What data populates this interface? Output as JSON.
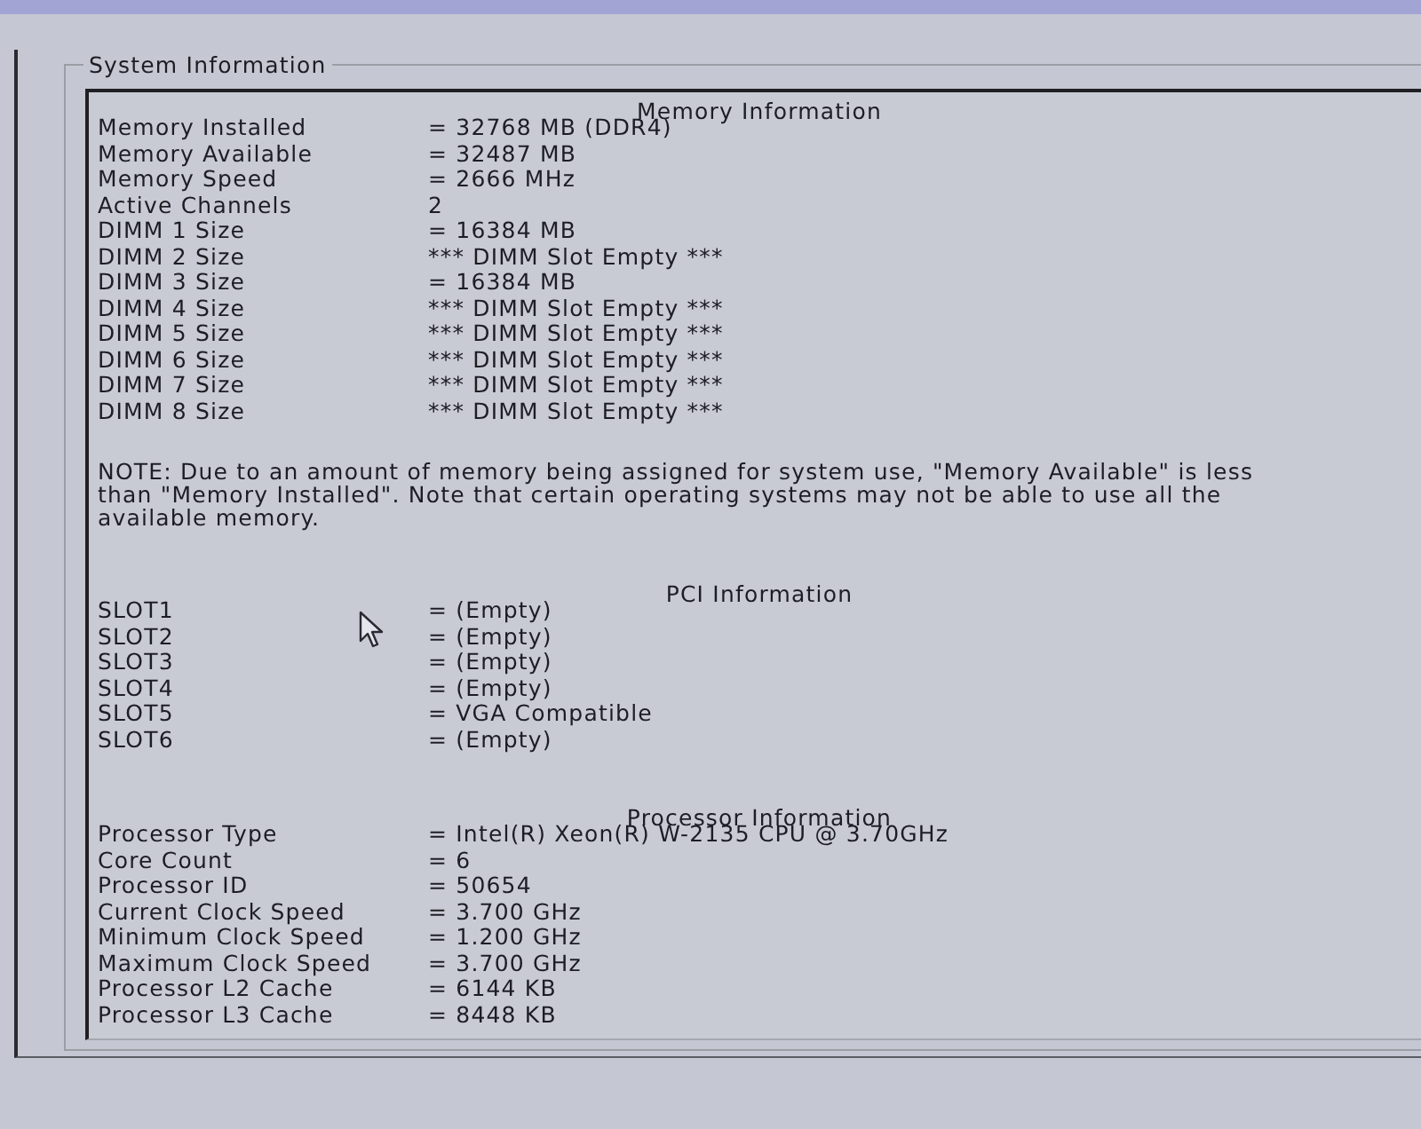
{
  "group": {
    "legend": "System Information"
  },
  "sections": [
    {
      "heading": "Memory Information",
      "rows": [
        {
          "label": "Memory Installed",
          "value": "= 32768 MB (DDR4)"
        },
        {
          "label": "Memory Available",
          "value": "= 32487 MB"
        },
        {
          "label": "Memory Speed",
          "value": "= 2666 MHz"
        },
        {
          "label": "Active Channels",
          "value": "2"
        },
        {
          "label": "DIMM 1 Size",
          "value": "= 16384 MB"
        },
        {
          "label": "DIMM 2 Size",
          "value": "*** DIMM Slot Empty ***"
        },
        {
          "label": "DIMM 3 Size",
          "value": "= 16384 MB"
        },
        {
          "label": "DIMM 4 Size",
          "value": "*** DIMM Slot Empty ***"
        },
        {
          "label": "DIMM 5 Size",
          "value": "*** DIMM Slot Empty ***"
        },
        {
          "label": "DIMM 6 Size",
          "value": "*** DIMM Slot Empty ***"
        },
        {
          "label": "DIMM 7 Size",
          "value": "*** DIMM Slot Empty ***"
        },
        {
          "label": "DIMM 8 Size",
          "value": "*** DIMM Slot Empty ***"
        }
      ],
      "note": "NOTE: Due to an amount of memory being assigned for system use, \"Memory Available\" is less than \"Memory Installed\". Note that certain operating systems may not be able to use all the available memory."
    },
    {
      "heading": "PCI Information",
      "rows": [
        {
          "label": "SLOT1",
          "value": "= (Empty)"
        },
        {
          "label": "SLOT2",
          "value": "= (Empty)"
        },
        {
          "label": "SLOT3",
          "value": "= (Empty)"
        },
        {
          "label": "SLOT4",
          "value": "= (Empty)"
        },
        {
          "label": "SLOT5",
          "value": "= VGA Compatible"
        },
        {
          "label": "SLOT6",
          "value": "= (Empty)"
        }
      ]
    },
    {
      "heading": "Processor Information",
      "rows": [
        {
          "label": "Processor Type",
          "value": "= Intel(R) Xeon(R) W-2135 CPU @ 3.70GHz"
        },
        {
          "label": "Core Count",
          "value": "= 6"
        },
        {
          "label": "Processor ID",
          "value": "= 50654"
        },
        {
          "label": "Current Clock Speed",
          "value": "= 3.700 GHz"
        },
        {
          "label": "Minimum Clock Speed",
          "value": "= 1.200 GHz"
        },
        {
          "label": "Maximum Clock Speed",
          "value": "= 3.700 GHz"
        },
        {
          "label": "Processor L2 Cache",
          "value": "= 6144 KB"
        },
        {
          "label": "Processor L3 Cache",
          "value": "= 8448 KB"
        }
      ]
    }
  ]
}
